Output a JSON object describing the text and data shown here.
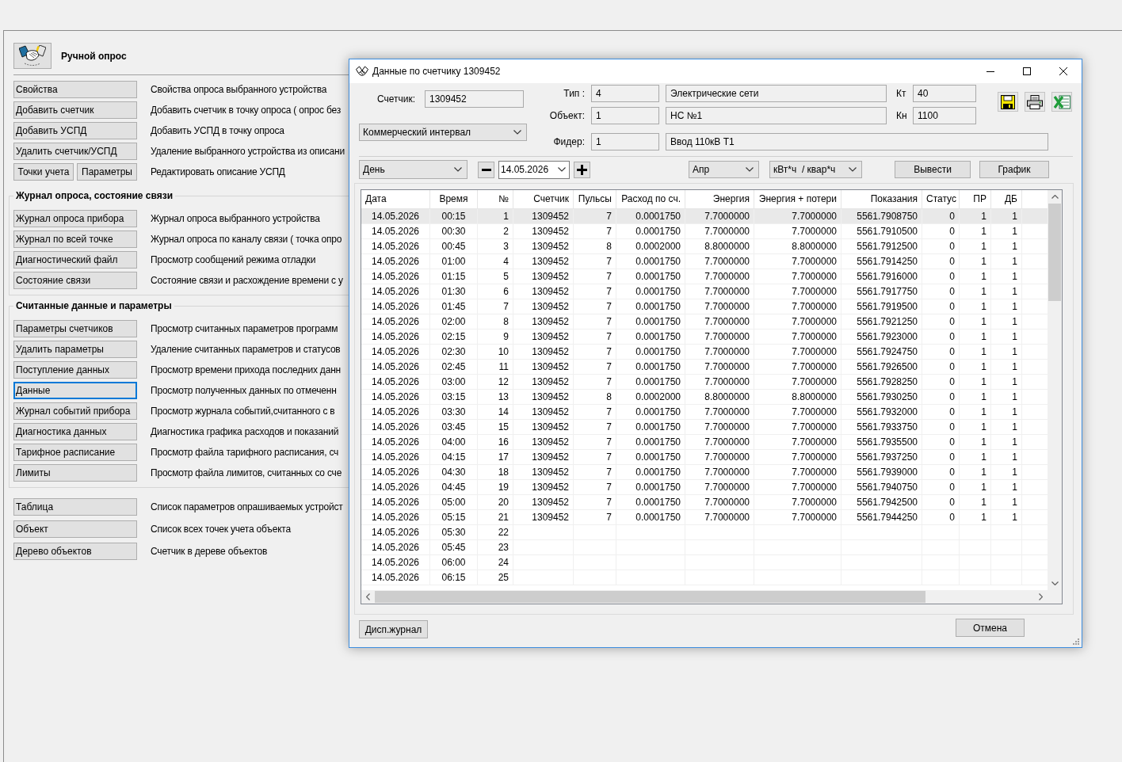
{
  "manual_poll": {
    "title": "Ручной опрос",
    "sections": [
      {
        "kind": "plain",
        "rows": [
          {
            "buttons": [
              {
                "label": "Свойства",
                "focused": false
              }
            ],
            "description": "Свойства опроса выбранного устройства"
          },
          {
            "buttons": [
              {
                "label": "Добавить счетчик",
                "focused": false
              }
            ],
            "description": "Добавить счетчик в точку опроса ( опрос без"
          },
          {
            "buttons": [
              {
                "label": "Добавить УСПД",
                "focused": false
              }
            ],
            "description": "Добавить УСПД в точку опроса"
          },
          {
            "buttons": [
              {
                "label": "Удалить счетчик/УСПД",
                "focused": false
              }
            ],
            "description": "Удаление выбранного устройства из описани"
          },
          {
            "buttons": [
              {
                "label": "Точки учета",
                "focused": false
              },
              {
                "label": "Параметры",
                "focused": false
              }
            ],
            "description": "Редактировать описание УСПД"
          }
        ]
      },
      {
        "kind": "group",
        "heading": "Журнал опроса, состояние связи",
        "rows": [
          {
            "buttons": [
              {
                "label": "Журнал опроса прибора",
                "focused": false
              }
            ],
            "description": "Журнал опроса выбранного устройства"
          },
          {
            "buttons": [
              {
                "label": "Журнал по всей точке",
                "focused": false
              }
            ],
            "description": "Журнал опроса по каналу связи ( точка опро"
          },
          {
            "buttons": [
              {
                "label": "Диагностический файл",
                "focused": false
              }
            ],
            "description": "Просмотр сообщений режима отладки"
          },
          {
            "buttons": [
              {
                "label": "Состояние связи",
                "focused": false
              }
            ],
            "description": "Состояние связи и расхождение времени с у"
          }
        ]
      },
      {
        "kind": "group",
        "heading": "Считанные данные и параметры",
        "rows": [
          {
            "buttons": [
              {
                "label": "Параметры счетчиков",
                "focused": false
              }
            ],
            "description": "Просмотр считанных параметров программ"
          },
          {
            "buttons": [
              {
                "label": "Удалить параметры",
                "focused": false
              }
            ],
            "description": "Удаление считанных параметров и статусов"
          },
          {
            "buttons": [
              {
                "label": "Поступление данных",
                "focused": false
              }
            ],
            "description": "Просмотр времени прихода последних данн"
          },
          {
            "buttons": [
              {
                "label": "Данные",
                "focused": true
              }
            ],
            "description": "Просмотр полученных данных по отмеченн"
          },
          {
            "buttons": [
              {
                "label": "Журнал событий прибора",
                "focused": false
              }
            ],
            "description": "Просмотр журнала событий,считанного с в"
          },
          {
            "buttons": [
              {
                "label": "Диагностика данных",
                "focused": false
              }
            ],
            "description": "Диагностика графика расходов и показаний"
          },
          {
            "buttons": [
              {
                "label": "Тарифное расписание",
                "focused": false
              }
            ],
            "description": "Просмотр файла тарифного расписания, сч"
          },
          {
            "buttons": [
              {
                "label": "Лимиты",
                "focused": false
              }
            ],
            "description": "Просмотр файла лимитов, считанных со сче"
          }
        ]
      },
      {
        "kind": "plain",
        "rows": [
          {
            "buttons": [
              {
                "label": "Таблица",
                "focused": false
              }
            ],
            "description": "Список параметров опрашиваемых устройст"
          },
          {
            "buttons": [
              {
                "label": "Объект",
                "focused": false
              }
            ],
            "description": "Список всех точек учета объекта"
          },
          {
            "buttons": [
              {
                "label": "Дерево объектов",
                "focused": false
              }
            ],
            "description": "Счетчик в дереве объектов"
          }
        ]
      }
    ]
  },
  "dialog": {
    "title": "Данные по счетчику 1309452",
    "meter": {
      "label": "Счетчик:",
      "value": "1309452"
    },
    "interval": {
      "value": "Коммерческий интервал"
    },
    "details": [
      {
        "label": "Тип :",
        "code": "4",
        "name": "Электрические сети",
        "coef_label": "Кт",
        "coef_value": "40"
      },
      {
        "label": "Объект:",
        "code": "1",
        "name": "НС №1",
        "coef_label": "Кн",
        "coef_value": "1100"
      },
      {
        "label": "Фидер:",
        "code": "1",
        "name": "Ввод 110кВ Т1"
      }
    ],
    "period": {
      "value": "День"
    },
    "date": {
      "value": "14.05.2026"
    },
    "month": {
      "value": "Апр"
    },
    "units": {
      "value": "кВт*ч  / квар*ч"
    },
    "actions": [
      {
        "label": "Вывести"
      },
      {
        "label": "График"
      }
    ],
    "table": {
      "columns": [
        "Дата",
        "Время",
        "№",
        "Счетчик",
        "Пульсы",
        "Расход по сч.",
        "Энергия",
        "Энергия + потери",
        "Показания",
        "Статус",
        "ПР",
        "ДБ"
      ],
      "rows": [
        {
          "selected": true,
          "cells": [
            "14.05.2026",
            "00:15",
            "1",
            "1309452",
            "7",
            "0.0001750",
            "7.7000000",
            "7.7000000",
            "5561.7908750",
            "0",
            "1",
            "1"
          ]
        },
        {
          "selected": false,
          "cells": [
            "14.05.2026",
            "00:30",
            "2",
            "1309452",
            "7",
            "0.0001750",
            "7.7000000",
            "7.7000000",
            "5561.7910500",
            "0",
            "1",
            "1"
          ]
        },
        {
          "selected": false,
          "cells": [
            "14.05.2026",
            "00:45",
            "3",
            "1309452",
            "8",
            "0.0002000",
            "8.8000000",
            "8.8000000",
            "5561.7912500",
            "0",
            "1",
            "1"
          ]
        },
        {
          "selected": false,
          "cells": [
            "14.05.2026",
            "01:00",
            "4",
            "1309452",
            "7",
            "0.0001750",
            "7.7000000",
            "7.7000000",
            "5561.7914250",
            "0",
            "1",
            "1"
          ]
        },
        {
          "selected": false,
          "cells": [
            "14.05.2026",
            "01:15",
            "5",
            "1309452",
            "7",
            "0.0001750",
            "7.7000000",
            "7.7000000",
            "5561.7916000",
            "0",
            "1",
            "1"
          ]
        },
        {
          "selected": false,
          "cells": [
            "14.05.2026",
            "01:30",
            "6",
            "1309452",
            "7",
            "0.0001750",
            "7.7000000",
            "7.7000000",
            "5561.7917750",
            "0",
            "1",
            "1"
          ]
        },
        {
          "selected": false,
          "cells": [
            "14.05.2026",
            "01:45",
            "7",
            "1309452",
            "7",
            "0.0001750",
            "7.7000000",
            "7.7000000",
            "5561.7919500",
            "0",
            "1",
            "1"
          ]
        },
        {
          "selected": false,
          "cells": [
            "14.05.2026",
            "02:00",
            "8",
            "1309452",
            "7",
            "0.0001750",
            "7.7000000",
            "7.7000000",
            "5561.7921250",
            "0",
            "1",
            "1"
          ]
        },
        {
          "selected": false,
          "cells": [
            "14.05.2026",
            "02:15",
            "9",
            "1309452",
            "7",
            "0.0001750",
            "7.7000000",
            "7.7000000",
            "5561.7923000",
            "0",
            "1",
            "1"
          ]
        },
        {
          "selected": false,
          "cells": [
            "14.05.2026",
            "02:30",
            "10",
            "1309452",
            "7",
            "0.0001750",
            "7.7000000",
            "7.7000000",
            "5561.7924750",
            "0",
            "1",
            "1"
          ]
        },
        {
          "selected": false,
          "cells": [
            "14.05.2026",
            "02:45",
            "11",
            "1309452",
            "7",
            "0.0001750",
            "7.7000000",
            "7.7000000",
            "5561.7926500",
            "0",
            "1",
            "1"
          ]
        },
        {
          "selected": false,
          "cells": [
            "14.05.2026",
            "03:00",
            "12",
            "1309452",
            "7",
            "0.0001750",
            "7.7000000",
            "7.7000000",
            "5561.7928250",
            "0",
            "1",
            "1"
          ]
        },
        {
          "selected": false,
          "cells": [
            "14.05.2026",
            "03:15",
            "13",
            "1309452",
            "8",
            "0.0002000",
            "8.8000000",
            "8.8000000",
            "5561.7930250",
            "0",
            "1",
            "1"
          ]
        },
        {
          "selected": false,
          "cells": [
            "14.05.2026",
            "03:30",
            "14",
            "1309452",
            "7",
            "0.0001750",
            "7.7000000",
            "7.7000000",
            "5561.7932000",
            "0",
            "1",
            "1"
          ]
        },
        {
          "selected": false,
          "cells": [
            "14.05.2026",
            "03:45",
            "15",
            "1309452",
            "7",
            "0.0001750",
            "7.7000000",
            "7.7000000",
            "5561.7933750",
            "0",
            "1",
            "1"
          ]
        },
        {
          "selected": false,
          "cells": [
            "14.05.2026",
            "04:00",
            "16",
            "1309452",
            "7",
            "0.0001750",
            "7.7000000",
            "7.7000000",
            "5561.7935500",
            "0",
            "1",
            "1"
          ]
        },
        {
          "selected": false,
          "cells": [
            "14.05.2026",
            "04:15",
            "17",
            "1309452",
            "7",
            "0.0001750",
            "7.7000000",
            "7.7000000",
            "5561.7937250",
            "0",
            "1",
            "1"
          ]
        },
        {
          "selected": false,
          "cells": [
            "14.05.2026",
            "04:30",
            "18",
            "1309452",
            "7",
            "0.0001750",
            "7.7000000",
            "7.7000000",
            "5561.7939000",
            "0",
            "1",
            "1"
          ]
        },
        {
          "selected": false,
          "cells": [
            "14.05.2026",
            "04:45",
            "19",
            "1309452",
            "7",
            "0.0001750",
            "7.7000000",
            "7.7000000",
            "5561.7940750",
            "0",
            "1",
            "1"
          ]
        },
        {
          "selected": false,
          "cells": [
            "14.05.2026",
            "05:00",
            "20",
            "1309452",
            "7",
            "0.0001750",
            "7.7000000",
            "7.7000000",
            "5561.7942500",
            "0",
            "1",
            "1"
          ]
        },
        {
          "selected": false,
          "cells": [
            "14.05.2026",
            "05:15",
            "21",
            "1309452",
            "7",
            "0.0001750",
            "7.7000000",
            "7.7000000",
            "5561.7944250",
            "0",
            "1",
            "1"
          ]
        },
        {
          "selected": false,
          "cells": [
            "14.05.2026",
            "05:30",
            "22"
          ]
        },
        {
          "selected": false,
          "cells": [
            "14.05.2026",
            "05:45",
            "23"
          ]
        },
        {
          "selected": false,
          "cells": [
            "14.05.2026",
            "06:00",
            "24"
          ]
        },
        {
          "selected": false,
          "cells": [
            "14.05.2026",
            "06:15",
            "25"
          ]
        }
      ]
    },
    "footer": {
      "journal_button": "Дисп.журнал",
      "cancel_button": "Отмена"
    }
  }
}
